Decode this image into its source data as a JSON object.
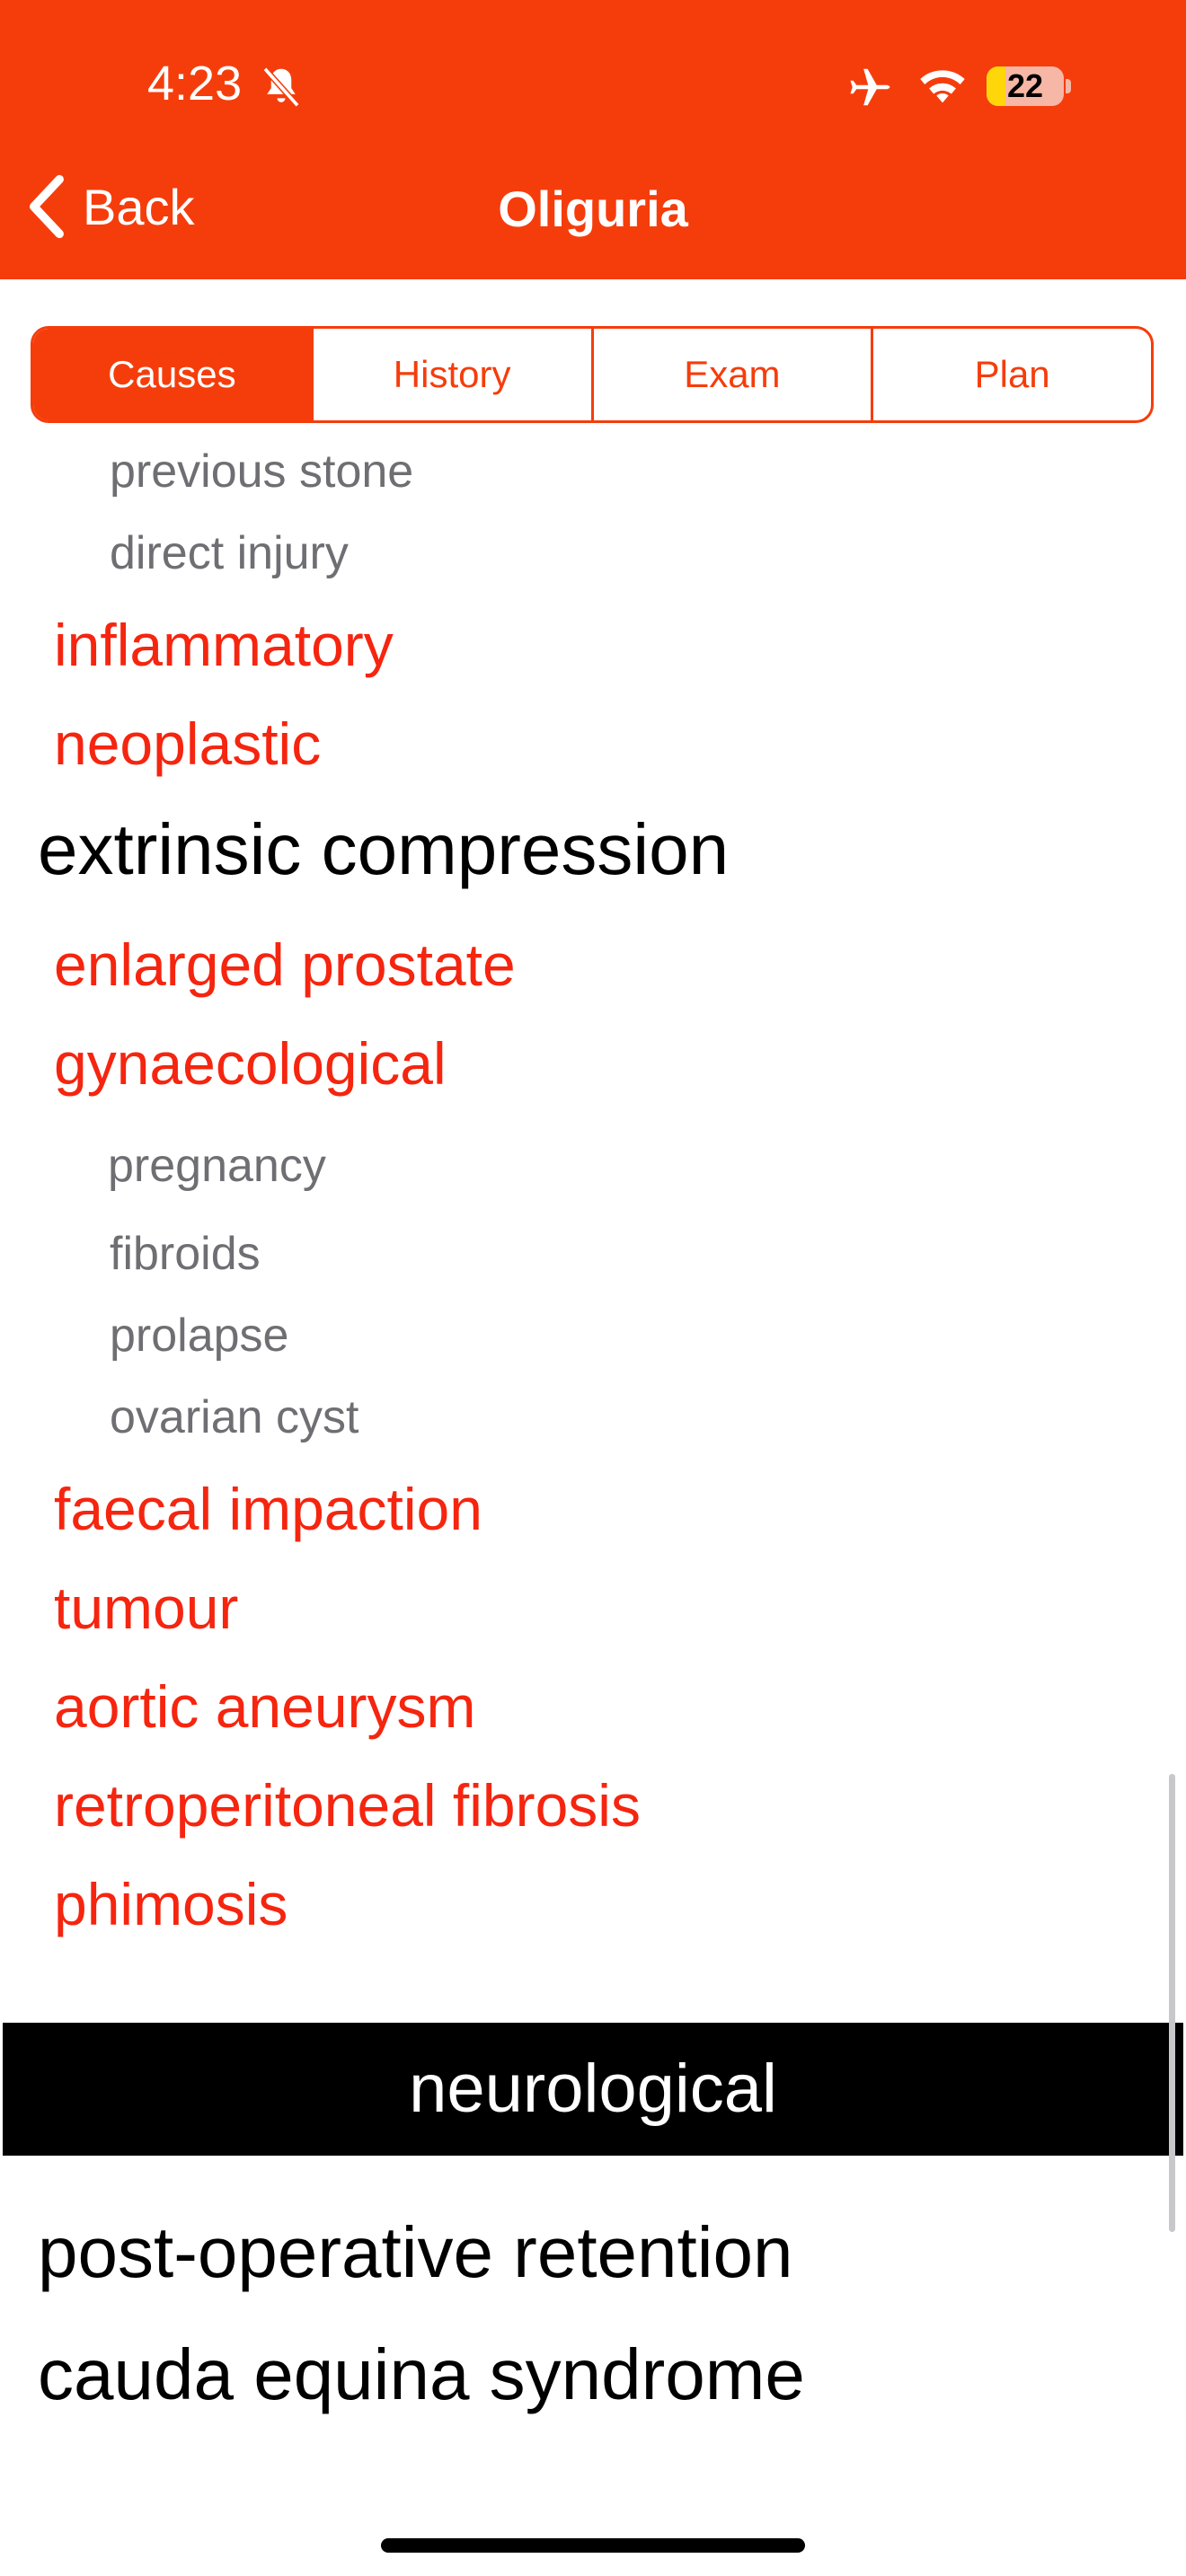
{
  "status_bar": {
    "time": "4:23",
    "battery": "22",
    "icons": [
      "bell-slash-icon",
      "airplane-icon",
      "wifi-icon",
      "battery-icon"
    ]
  },
  "nav": {
    "back_label": "Back",
    "title": "Oliguria"
  },
  "segments": [
    "Causes",
    "History",
    "Exam",
    "Plan"
  ],
  "active_segment": "Causes",
  "content": {
    "sub_top": [
      "previous stone",
      "direct injury"
    ],
    "red_top": [
      "inflammatory",
      "neoplastic"
    ],
    "heading_extrinsic": "extrinsic compression",
    "red_mid": [
      "enlarged prostate",
      "gynaecological"
    ],
    "sub_gyn": [
      "pregnancy",
      "fibroids",
      "prolapse",
      "ovarian cyst"
    ],
    "red_bottom": [
      "faecal impaction",
      "tumour",
      "aortic aneurysm",
      "retroperitoneal fibrosis",
      "phimosis"
    ],
    "section_neurological": "neurological",
    "heading_post_op": "post-operative retention",
    "heading_cauda": "cauda equina syndrome"
  },
  "colors": {
    "accent": "#f53d0c",
    "link_red": "#f5250f",
    "sub_grey": "#6e6e73"
  }
}
